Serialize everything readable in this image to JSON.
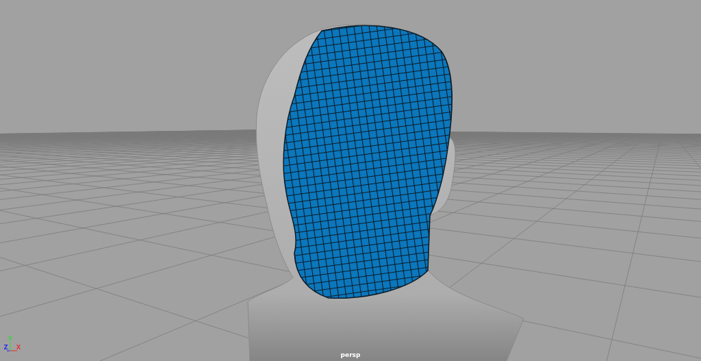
{
  "viewport": {
    "camera_label": "persp"
  },
  "axis_gizmo": {
    "axes": [
      {
        "label": "Y",
        "color": "#3fd13f"
      },
      {
        "label": "Z",
        "color": "#2f2ff0"
      },
      {
        "label": "X",
        "color": "#e23b3b"
      }
    ]
  }
}
